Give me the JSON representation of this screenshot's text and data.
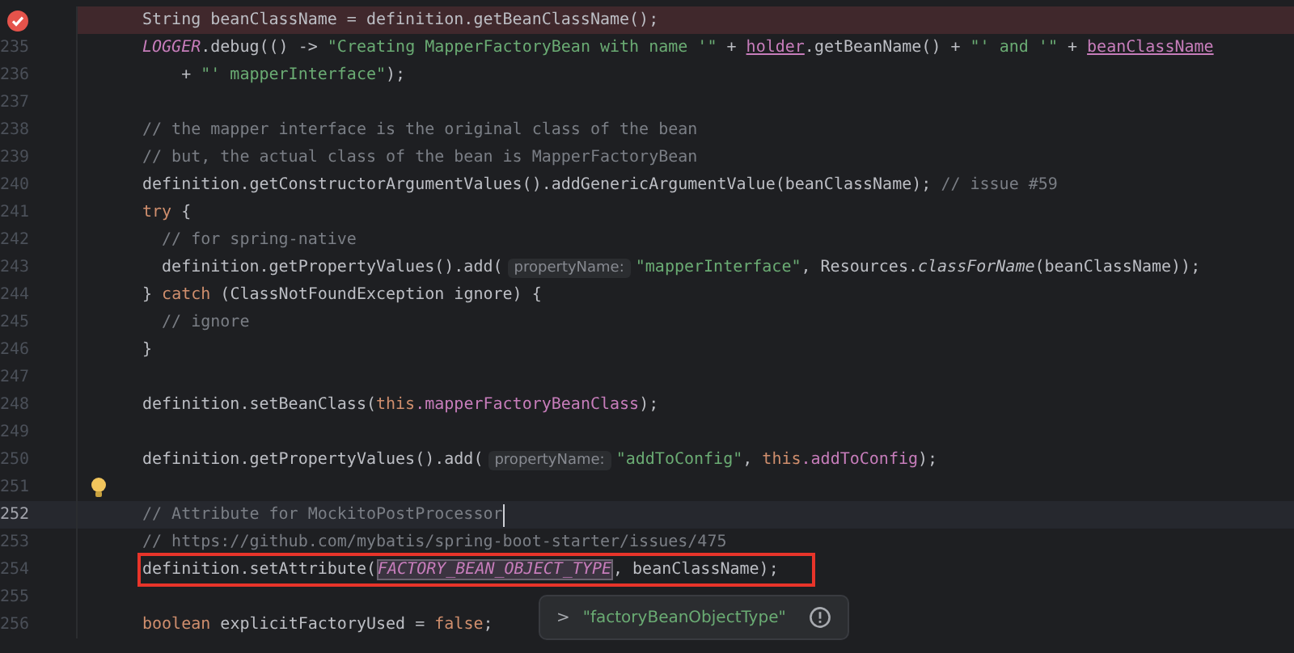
{
  "editor": {
    "lines": [
      {
        "kind": "breakpoint",
        "tokens": [
          {
            "kind": "plain",
            "text": "String beanClassName = definition.getBeanClassName();"
          }
        ]
      },
      {
        "kind": "code",
        "number": "235",
        "tokens": [
          {
            "kind": "static",
            "text": "LOGGER"
          },
          {
            "kind": "plain",
            "text": ".debug(() -> "
          },
          {
            "kind": "string",
            "text": "\"Creating MapperFactoryBean with name '\""
          },
          {
            "kind": "plain",
            "text": " + "
          },
          {
            "kind": "captured",
            "text": "holder"
          },
          {
            "kind": "plain",
            "text": ".getBeanName() + "
          },
          {
            "kind": "string",
            "text": "\"' and '\""
          },
          {
            "kind": "plain",
            "text": " + "
          },
          {
            "kind": "captured",
            "text": "beanClassName"
          }
        ]
      },
      {
        "kind": "code",
        "number": "236",
        "tokens": [
          {
            "kind": "plain",
            "text": "    + "
          },
          {
            "kind": "string",
            "text": "\"' mapperInterface\""
          },
          {
            "kind": "plain",
            "text": ");"
          }
        ]
      },
      {
        "kind": "code",
        "number": "237"
      },
      {
        "kind": "code",
        "number": "238",
        "tokens": [
          {
            "kind": "comment",
            "text": "// the mapper interface is the original class of the bean"
          }
        ]
      },
      {
        "kind": "code",
        "number": "239",
        "tokens": [
          {
            "kind": "comment",
            "text": "// but, the actual class of the bean is MapperFactoryBean"
          }
        ]
      },
      {
        "kind": "code",
        "number": "240",
        "tokens": [
          {
            "kind": "plain",
            "text": "definition.getConstructorArgumentValues().addGenericArgumentValue(beanClassName); "
          },
          {
            "kind": "comment",
            "text": "// issue #59"
          }
        ]
      },
      {
        "kind": "code",
        "number": "241",
        "tokens": [
          {
            "kind": "keyword",
            "text": "try"
          },
          {
            "kind": "plain",
            "text": " {"
          }
        ]
      },
      {
        "kind": "code",
        "number": "242",
        "tokens": [
          {
            "kind": "comment",
            "text": "  // for spring-native"
          }
        ]
      },
      {
        "kind": "code",
        "number": "243",
        "tokens": [
          {
            "kind": "plain",
            "text": "  definition.getPropertyValues().add("
          },
          {
            "kind": "hint",
            "text": "propertyName:"
          },
          {
            "kind": "string",
            "text": "\"mapperInterface\""
          },
          {
            "kind": "plain",
            "text": ", Resources."
          },
          {
            "kind": "italic",
            "text": "classForName"
          },
          {
            "kind": "plain",
            "text": "(beanClassName));"
          }
        ]
      },
      {
        "kind": "code",
        "number": "244",
        "tokens": [
          {
            "kind": "plain",
            "text": "} "
          },
          {
            "kind": "keyword",
            "text": "catch"
          },
          {
            "kind": "plain",
            "text": " (ClassNotFoundException ignore) {"
          }
        ]
      },
      {
        "kind": "code",
        "number": "245",
        "tokens": [
          {
            "kind": "comment",
            "text": "  // ignore"
          }
        ]
      },
      {
        "kind": "code",
        "number": "246",
        "tokens": [
          {
            "kind": "plain",
            "text": "}"
          }
        ]
      },
      {
        "kind": "code",
        "number": "247"
      },
      {
        "kind": "code",
        "number": "248",
        "tokens": [
          {
            "kind": "plain",
            "text": "definition.setBeanClass("
          },
          {
            "kind": "keyword",
            "text": "this"
          },
          {
            "kind": "field",
            "text": ".mapperFactoryBeanClass"
          },
          {
            "kind": "plain",
            "text": ");"
          }
        ]
      },
      {
        "kind": "code",
        "number": "249"
      },
      {
        "kind": "code",
        "number": "250",
        "tokens": [
          {
            "kind": "plain",
            "text": "definition.getPropertyValues().add("
          },
          {
            "kind": "hint",
            "text": "propertyName:"
          },
          {
            "kind": "string",
            "text": "\"addToConfig\""
          },
          {
            "kind": "plain",
            "text": ", "
          },
          {
            "kind": "keyword",
            "text": "this"
          },
          {
            "kind": "field",
            "text": ".addToConfig"
          },
          {
            "kind": "plain",
            "text": ");"
          }
        ]
      },
      {
        "kind": "bulb",
        "number": "251"
      },
      {
        "kind": "code",
        "number": "252",
        "current": true,
        "cursor": true,
        "tokens": [
          {
            "kind": "comment",
            "text": "// Attribute for MockitoPostProcessor"
          }
        ]
      },
      {
        "kind": "code",
        "number": "253",
        "tokens": [
          {
            "kind": "comment",
            "text": "// https://github.com/mybatis/spring-boot-starter/issues/475"
          }
        ]
      },
      {
        "kind": "code",
        "number": "254",
        "boxed": true,
        "tokens": [
          {
            "kind": "plain",
            "text": "definition.setAttribute("
          },
          {
            "kind": "selected_static",
            "text": "FACTORY_BEAN_OBJECT_TYPE"
          },
          {
            "kind": "plain",
            "text": ", beanClassName);"
          }
        ]
      },
      {
        "kind": "code",
        "number": "255"
      },
      {
        "kind": "code",
        "number": "256",
        "tokens": [
          {
            "kind": "keyword",
            "text": "boolean"
          },
          {
            "kind": "plain",
            "text": " explicitFactoryUsed = "
          },
          {
            "kind": "keyword",
            "text": "false"
          },
          {
            "kind": "plain",
            "text": ";"
          }
        ]
      }
    ],
    "popup": {
      "chevron": ">",
      "text": "\"factoryBeanObjectType\""
    }
  }
}
